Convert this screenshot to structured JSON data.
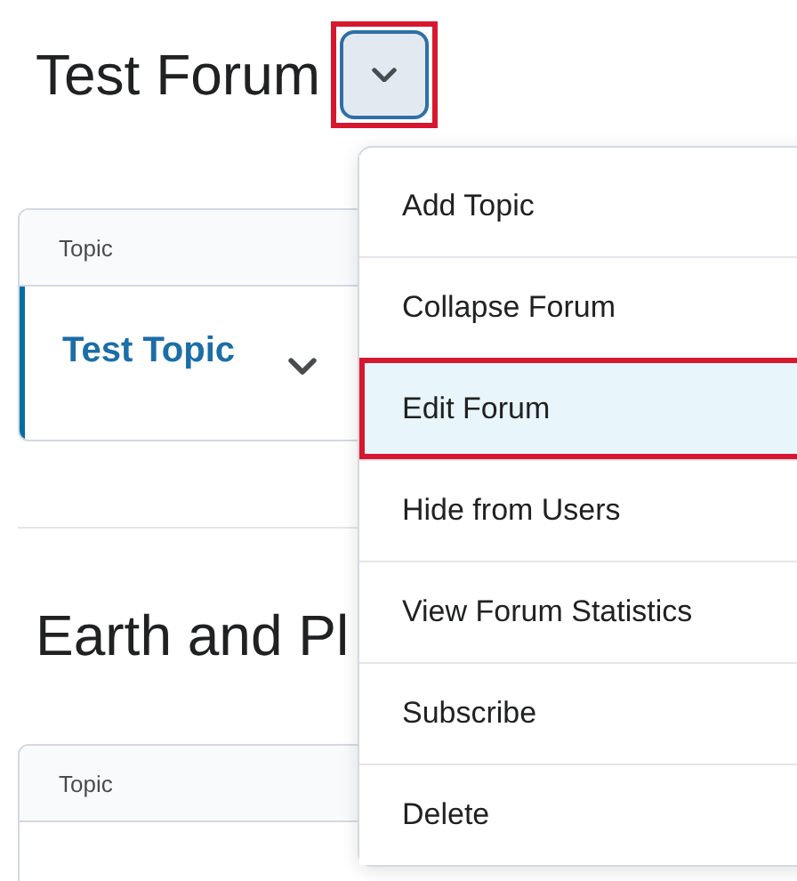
{
  "forums": [
    {
      "title": "Test Forum",
      "menu_button": {
        "annotated": true
      },
      "table": {
        "column_1": "Topic",
        "rows": [
          {
            "topic": "Test Topic"
          }
        ]
      }
    },
    {
      "title": "Earth and Pl",
      "table": {
        "column_1": "Topic"
      }
    }
  ],
  "menu": {
    "items": [
      {
        "label": "Add Topic",
        "selected": false,
        "annotated": false
      },
      {
        "label": "Collapse Forum",
        "selected": false,
        "annotated": false
      },
      {
        "label": "Edit Forum",
        "selected": true,
        "annotated": true
      },
      {
        "label": "Hide from Users",
        "selected": false,
        "annotated": false
      },
      {
        "label": "View Forum Statistics",
        "selected": false,
        "annotated": false
      },
      {
        "label": "Subscribe",
        "selected": false,
        "annotated": false
      },
      {
        "label": "Delete",
        "selected": false,
        "annotated": false
      }
    ]
  }
}
